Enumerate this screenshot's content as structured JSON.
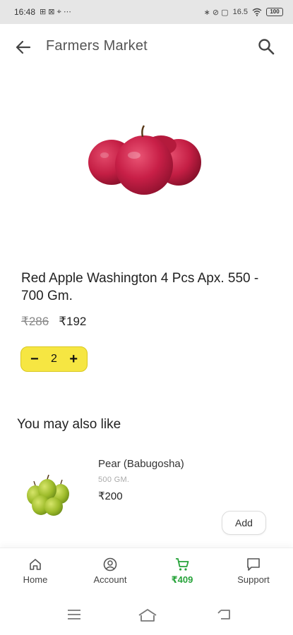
{
  "status_bar": {
    "time": "16:48",
    "left_glyphs": "⊞ ⊠ ⌖ ⋯",
    "right_glyphs": "∗ ⊘ ▢",
    "network_speed": "16.5",
    "battery": "100"
  },
  "app_bar": {
    "title": "Farmers Market"
  },
  "product": {
    "title": "Red Apple Washington 4 Pcs Apx. 550 - 700 Gm.",
    "mrp": "₹286",
    "price": "₹192",
    "quantity": "2",
    "minus_label": "−",
    "plus_label": "+"
  },
  "suggestions": {
    "section_title": "You may also like",
    "items": [
      {
        "name": "Pear (Babugosha)",
        "weight": "500 GM.",
        "price": "₹200",
        "add_label": "Add"
      }
    ]
  },
  "bottom_nav": {
    "items": [
      {
        "label": "Home",
        "icon": "home-icon"
      },
      {
        "label": "Account",
        "icon": "account-icon"
      },
      {
        "label": "₹409",
        "icon": "cart-icon"
      },
      {
        "label": "Support",
        "icon": "chat-icon"
      }
    ],
    "active_color": "#27a33a"
  },
  "colors": {
    "stepper_bg": "#f6e642",
    "accent_green": "#27a33a",
    "status_bar_bg": "#e6e6e6"
  }
}
